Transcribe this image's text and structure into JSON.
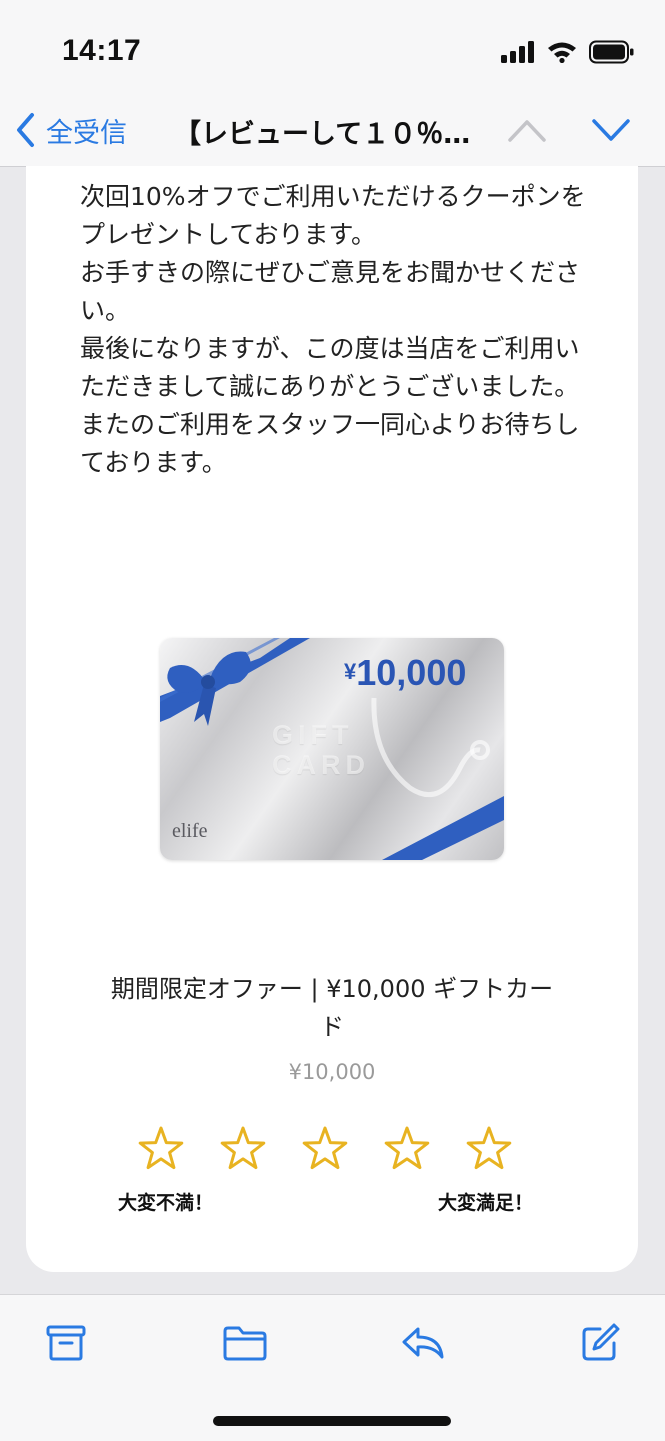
{
  "status": {
    "time": "14:17",
    "icons": [
      "signal-icon",
      "wifi-icon",
      "battery-icon"
    ]
  },
  "nav": {
    "back_label": "全受信",
    "subject": "【レビューして１０％オ…",
    "accent_color": "#2a7ae2"
  },
  "message": {
    "paragraphs": [
      "次回10%オフでご利用いただけるクーポンをプレゼントしております。",
      "お手すきの際にぜひご意見をお聞かせください。",
      "最後になりますが、この度は当店をご利用いただきまして誠にありがとうございました。",
      "またのご利用をスタッフ一同心よりお待ちしております。"
    ]
  },
  "gift_card": {
    "amount_symbol": "¥",
    "amount": "10,000",
    "gift_word": "GIFT CARD",
    "brand": "elife",
    "ribbon_color": "#2f5fc0"
  },
  "product": {
    "name": "期間限定オファー | ¥10,000 ギフトカード",
    "price": "¥10,000"
  },
  "rating": {
    "star_count": 5,
    "star_color": "#e8b321",
    "label_low": "大変不満！",
    "label_high": "大変満足！"
  },
  "toolbar": {
    "items": [
      "archive-icon",
      "folder-icon",
      "reply-icon",
      "compose-icon"
    ]
  }
}
